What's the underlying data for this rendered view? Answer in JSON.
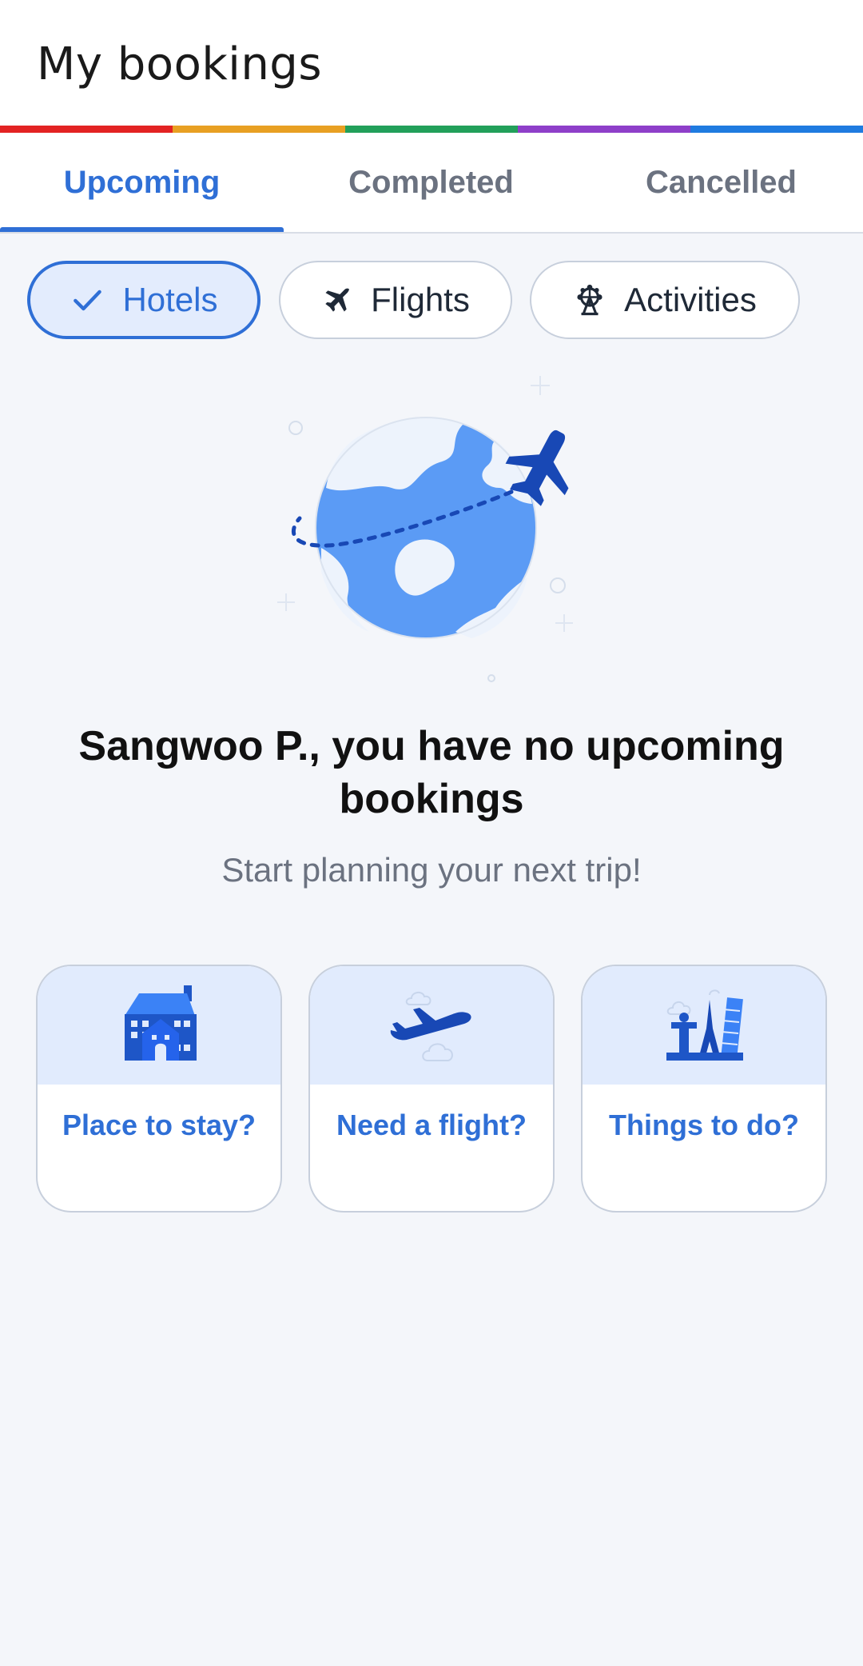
{
  "header": {
    "title": "My bookings"
  },
  "rainbow_colors": [
    "#e32323",
    "#e8a023",
    "#22a05a",
    "#8e3fc9",
    "#1f7be0"
  ],
  "tabs": [
    {
      "label": "Upcoming",
      "active": true
    },
    {
      "label": "Completed",
      "active": false
    },
    {
      "label": "Cancelled",
      "active": false
    }
  ],
  "filters": [
    {
      "label": "Hotels",
      "icon": "check-icon",
      "selected": true
    },
    {
      "label": "Flights",
      "icon": "airplane-icon",
      "selected": false
    },
    {
      "label": "Activities",
      "icon": "ferris-wheel-icon",
      "selected": false
    }
  ],
  "empty_state": {
    "headline": "Sangwoo P., you have no upcoming bookings",
    "subline": "Start planning your next trip!"
  },
  "cards": [
    {
      "label": "Place to stay?",
      "icon": "hotel-building-icon"
    },
    {
      "label": "Need a flight?",
      "icon": "airplane-takeoff-icon"
    },
    {
      "label": "Things to do?",
      "icon": "landmarks-icon"
    }
  ],
  "colors": {
    "accent": "#2f6fd6",
    "accent_light": "#e3ecfd",
    "background": "#f4f6fa"
  }
}
